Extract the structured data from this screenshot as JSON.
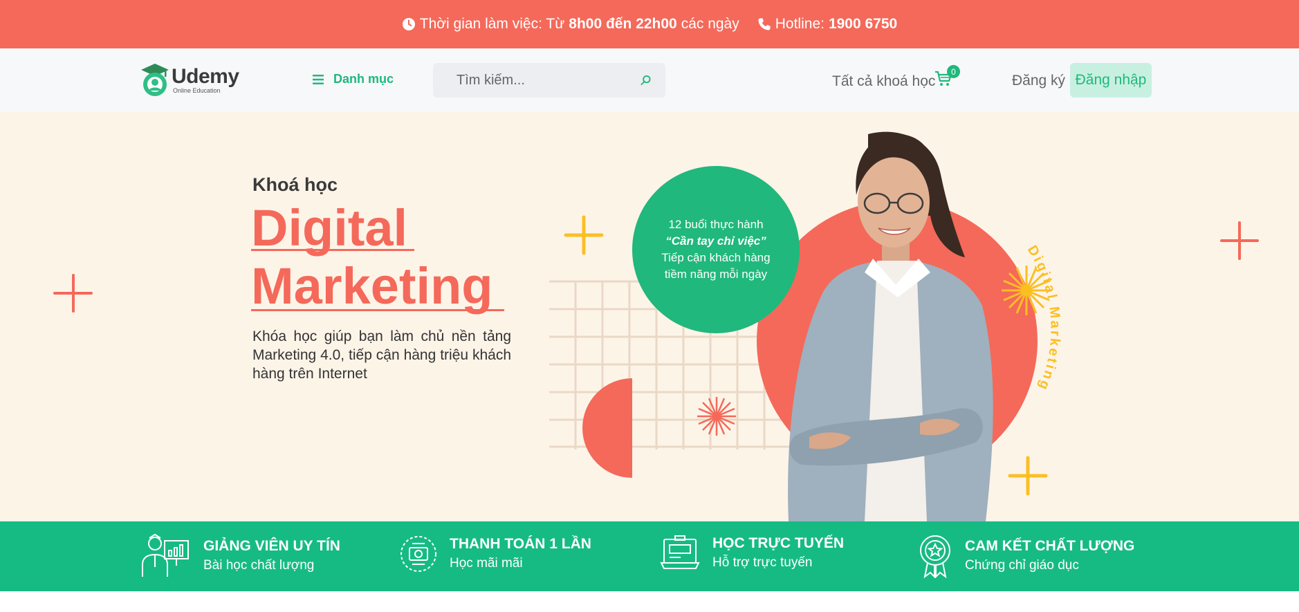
{
  "topbar": {
    "hours_prefix": "Thời gian làm việc: Từ",
    "hours_bold": "8h00 đến 22h00",
    "hours_suffix": "các ngày",
    "hotline_label": "Hotline:",
    "hotline_number": "1900 6750"
  },
  "header": {
    "logo_name": "Udemy",
    "logo_sub": "Online Education",
    "menu_label": "Danh mục",
    "search_placeholder": "Tìm kiếm...",
    "courses_link": "Tất cả khoá học",
    "cart_count": "0",
    "register_label": "Đăng ký",
    "login_label": "Đăng nhập"
  },
  "hero": {
    "eyebrow": "Khoá học",
    "title_line1": "Digital",
    "title_line2": "Marketing",
    "description": "Khóa học giúp bạn làm chủ nền tảng Marketing 4.0, tiếp cận hàng triệu khách hàng trên Internet",
    "bubble_line1": "12 buổi thực hành",
    "bubble_line2": "“Cần tay chỉ việc”",
    "bubble_line3": "Tiếp cận khách hàng",
    "bubble_line4": "tiềm năng mỗi ngày",
    "curved_text": "Digital Marketing"
  },
  "features": [
    {
      "title": "GIẢNG VIÊN UY TÍN",
      "subtitle": "Bài học chất lượng",
      "icon": "teacher-icon"
    },
    {
      "title": "THANH TOÁN 1 LẦN",
      "subtitle": "Học mãi mãi",
      "icon": "payment-icon"
    },
    {
      "title": "HỌC TRỰC TUYẾN",
      "subtitle": "Hỗ trợ trực tuyến",
      "icon": "online-learning-icon"
    },
    {
      "title": "CAM KẾT CHẤT LƯỢNG",
      "subtitle": "Chứng chỉ giáo dục",
      "icon": "certificate-icon"
    }
  ],
  "colors": {
    "accent_red": "#f4695a",
    "brand_green": "#20b87c",
    "feature_green": "#16bb83",
    "hero_bg": "#fdf4e8",
    "sunburst_yellow": "#fbbf24"
  }
}
